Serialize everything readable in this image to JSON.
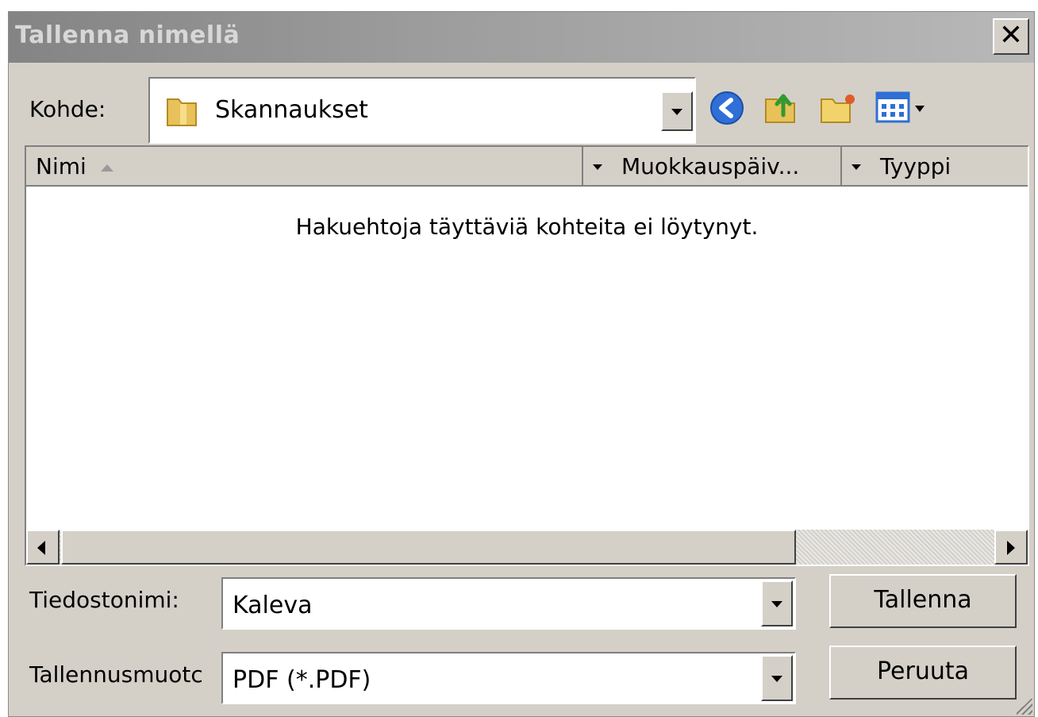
{
  "dialog": {
    "title": "Tallenna nimellä",
    "close_glyph": "✕"
  },
  "location": {
    "label": "Kohde:",
    "folder": "Skannaukset",
    "folder_icon": "folder-icon"
  },
  "toolbar": {
    "icons": [
      "back-icon",
      "up-folder-icon",
      "new-folder-icon",
      "view-menu-icon"
    ]
  },
  "list": {
    "columns": [
      "Nimi",
      "Muokkauspäiv...",
      "Tyyppi"
    ],
    "empty_message": "Hakuehtoja täyttäviä kohteita ei löytynyt."
  },
  "form": {
    "filename_label": "Tiedostonimi:",
    "filename_value": "Kaleva",
    "format_label": "Tallennusmuotc",
    "format_value": "PDF (*.PDF)"
  },
  "buttons": {
    "save": "Tallenna",
    "cancel": "Peruuta"
  },
  "colors": {
    "dialog_bg": "#d4d0c8",
    "title_gradient_start": "#848484",
    "title_text": "#d7d7d7"
  }
}
